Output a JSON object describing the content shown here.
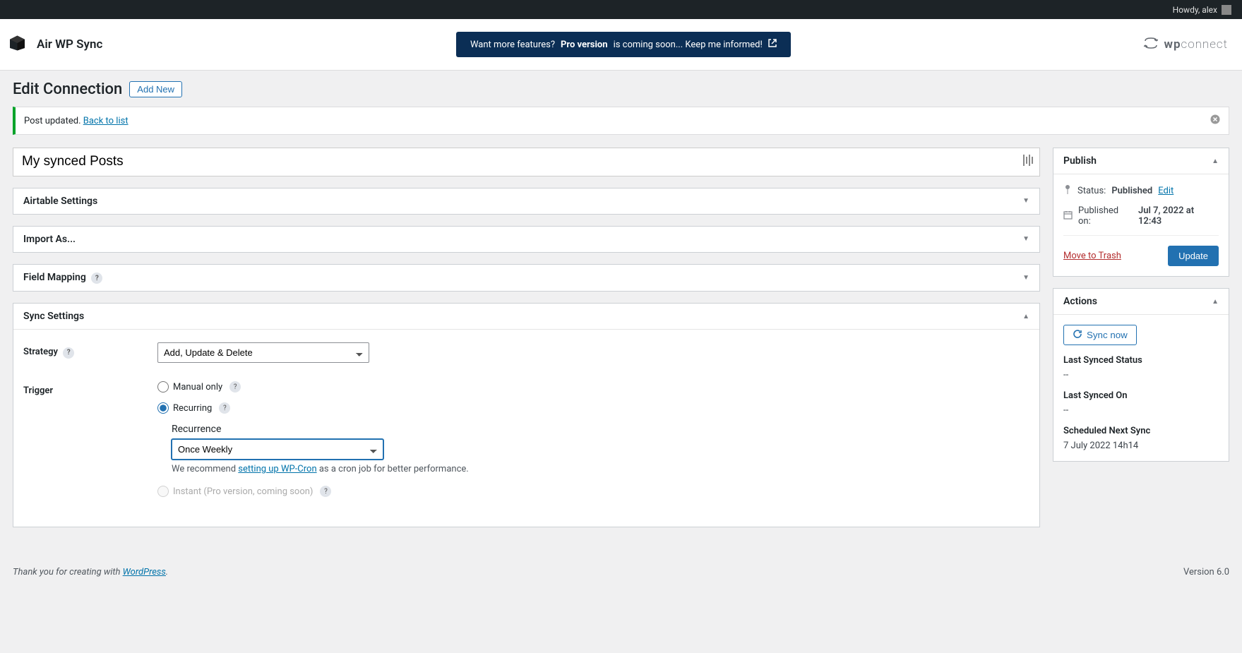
{
  "adminbar": {
    "greeting": "Howdy, alex"
  },
  "brand": {
    "title": "Air WP Sync"
  },
  "banner": {
    "prefix": "Want more features? ",
    "bold": "Pro version",
    "suffix": " is coming soon... Keep me informed!"
  },
  "wpconnect": {
    "wp": "wp",
    "connect": "connect"
  },
  "page": {
    "heading": "Edit Connection",
    "add_new": "Add New"
  },
  "notice": {
    "text": "Post updated. ",
    "link": "Back to list"
  },
  "title_field": {
    "value": "My synced Posts"
  },
  "boxes": {
    "airtable": "Airtable Settings",
    "import_as": "Import As...",
    "field_mapping": "Field Mapping",
    "sync_settings": "Sync Settings"
  },
  "sync": {
    "strategy_label": "Strategy",
    "strategy_value": "Add, Update & Delete",
    "trigger_label": "Trigger",
    "opt_manual": "Manual only",
    "opt_recurring": "Recurring",
    "recurrence_label": "Recurrence",
    "recurrence_value": "Once Weekly",
    "hint_prefix": "We recommend ",
    "hint_link": "setting up WP-Cron",
    "hint_suffix": " as a cron job for better performance.",
    "opt_instant": "Instant (Pro version, coming soon)"
  },
  "publish": {
    "title": "Publish",
    "status_label": "Status:",
    "status_value": "Published",
    "edit": "Edit",
    "published_on_label": "Published on:",
    "published_on_value": "Jul 7, 2022 at 12:43",
    "trash": "Move to Trash",
    "update": "Update"
  },
  "actions": {
    "title": "Actions",
    "sync_now": "Sync now",
    "last_status_label": "Last Synced Status",
    "last_status_value": "--",
    "last_on_label": "Last Synced On",
    "last_on_value": "--",
    "next_label": "Scheduled Next Sync",
    "next_value": "7 July 2022 14h14"
  },
  "footer": {
    "thanks_prefix": "Thank you for creating with ",
    "wp": "WordPress",
    "period": ".",
    "version": "Version 6.0"
  }
}
